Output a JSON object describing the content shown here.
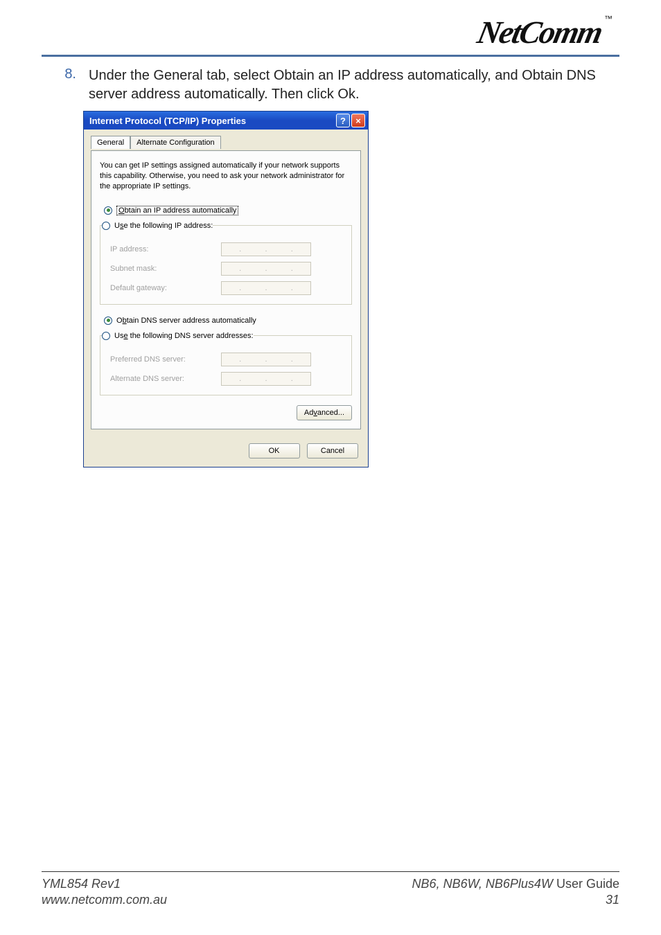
{
  "header": {
    "brand": "NetComm",
    "tm": "™"
  },
  "instruction": {
    "number": "8.",
    "text": "Under the General tab, select Obtain an IP address automatically, and Obtain DNS server address automatically. Then click Ok."
  },
  "dialog": {
    "title": "Internet Protocol (TCP/IP) Properties",
    "tabs": {
      "general": "General",
      "alternate": "Alternate Configuration"
    },
    "intro": "You can get IP settings assigned automatically if your network supports this capability. Otherwise, you need to ask your network administrator for the appropriate IP settings.",
    "radios": {
      "obtain_ip": "Obtain an IP address automatically",
      "use_ip": "Use the following IP address:",
      "obtain_dns": "Obtain DNS server address automatically",
      "use_dns": "Use the following DNS server addresses:"
    },
    "fields": {
      "ip_address": "IP address:",
      "subnet_mask": "Subnet mask:",
      "default_gateway": "Default gateway:",
      "preferred_dns": "Preferred DNS server:",
      "alternate_dns": "Alternate DNS server:"
    },
    "buttons": {
      "advanced": "Advanced...",
      "ok": "OK",
      "cancel": "Cancel"
    }
  },
  "footer": {
    "rev": "YML854 Rev1",
    "url": "www.netcomm.com.au",
    "guide": "NB6, NB6W, NB6Plus4W User Guide",
    "page": "31"
  }
}
